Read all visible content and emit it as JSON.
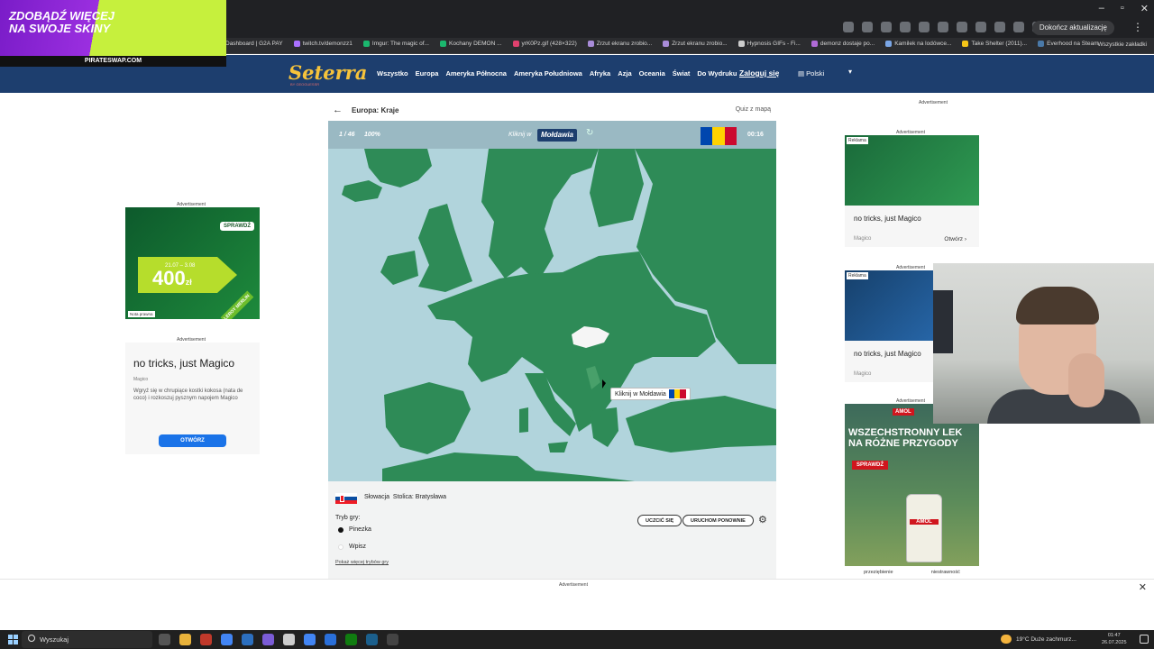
{
  "promo": {
    "line1": "ZDOBĄDŹ WIĘCEJ",
    "line2": "NA SWOJE SKINY",
    "url": "PIRATESWAP.COM"
  },
  "browser": {
    "update_label": "Dokończ aktualizację",
    "bookmarks": [
      "Dashboard | G2A PAY",
      "twitch.tv/demonzz1",
      "Imgur: The magic of...",
      "Kochany DEMON ...",
      "yrK0Pz.gif (428×322)",
      "Zrzut ekranu zrobio...",
      "Zrzut ekranu zrobio...",
      "Hypnosis GIFs - Fi...",
      "demonz dostaje po...",
      "Kamilek na lodówce...",
      "Take Shelter (2011)...",
      "Everhood na Steam"
    ],
    "bookmarks_all": "Wszystkie zakładki"
  },
  "site": {
    "logo": "Seterra",
    "logo_sub": "BY GEOGUESSR",
    "nav": [
      "Wszystko",
      "Europa",
      "Ameryka Północna",
      "Ameryka Południowa",
      "Afryka",
      "Azja",
      "Oceania",
      "Świat",
      "Do Wydruku"
    ],
    "login": "Zaloguj się",
    "language": "Polski"
  },
  "quiz": {
    "title": "Europa: Kraje",
    "map_link": "Quiz z mapą",
    "progress": "1 / 46",
    "percent": "100%",
    "prompt_label": "Kliknij w",
    "target": "Mołdawia",
    "timer": "00:16",
    "tooltip": "Kliknij w Mołdawia",
    "answer_country": "Słowacja",
    "answer_capital": "Stolica: Bratysława",
    "mode_label": "Tryb gry:",
    "mode_pin": "Pinezka",
    "mode_type": "Wpisz",
    "more_modes": "Pokaż więcej trybów gry",
    "learn_btn": "UCZCIĆ SIĘ",
    "restart_btn": "URUCHOM PONOWNIE"
  },
  "colors": {
    "land": "#2e8b57",
    "sea": "#b1d4dc",
    "highlight": "#f5f5f5",
    "header": "#1d3e6e"
  },
  "ads": {
    "advertisement": "Advertisement",
    "left_top": {
      "cta": "SPRAWDŹ",
      "amount": "400",
      "unit": "zł",
      "dates": "21.07 – 3.08",
      "note": "Nota prawna",
      "brand": "LEROY MERLIN"
    },
    "left_bottom": {
      "headline": "no tricks, just Magico",
      "brand": "Magico",
      "desc": "Wgryź się w chrupiące kostki kokosa (nata de coco) i rozkoszuj pysznym napojem Magico",
      "button": "OTWÓRZ"
    },
    "right_1": {
      "tag": "Reklama",
      "headline": "no tricks, just Magico",
      "brand": "Magico",
      "open": "Otwórz"
    },
    "right_2": {
      "tag": "Reklama",
      "headline": "no tricks, just Magico",
      "brand": "Magico"
    },
    "right_3": {
      "headline": "WSZECHSTRONNY LEK NA RÓŻNE PRZYGODY",
      "cta": "SPRAWDŹ",
      "product": "AMOL",
      "foot_1": "przeziębienie",
      "foot_2": "niestrawność"
    }
  },
  "taskbar": {
    "search": "Wyszukaj",
    "weather": "19°C  Duże zachmurz...",
    "time": "01:47",
    "date": "26.07.2025"
  }
}
